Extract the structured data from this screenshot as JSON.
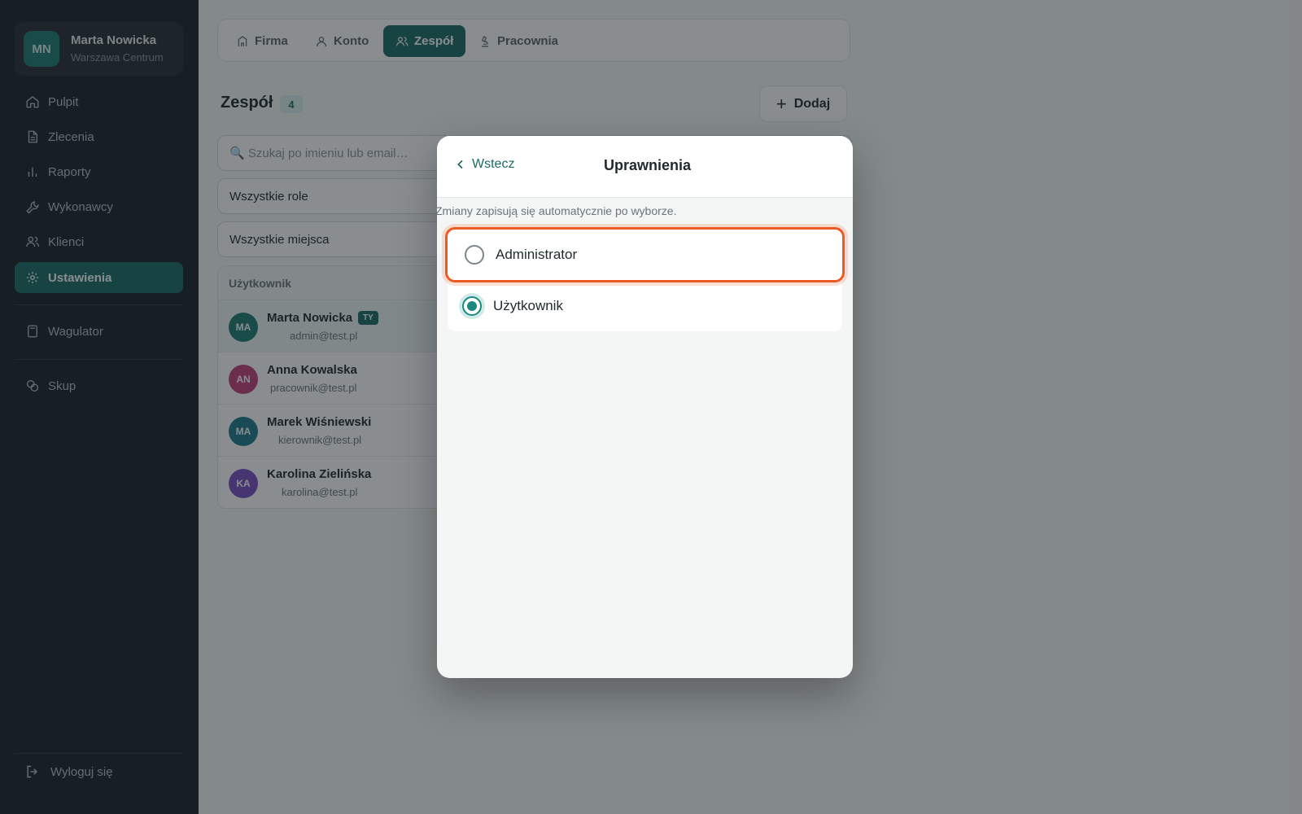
{
  "profile": {
    "initials": "MN",
    "name": "Marta Nowicka",
    "location": "Warszawa Centrum"
  },
  "sidebar": {
    "items": [
      {
        "label": "Pulpit",
        "icon": "home-icon"
      },
      {
        "label": "Zlecenia",
        "icon": "document-icon"
      },
      {
        "label": "Raporty",
        "icon": "bar-chart-icon"
      },
      {
        "label": "Wykonawcy",
        "icon": "wrench-icon"
      },
      {
        "label": "Klienci",
        "icon": "users-icon"
      },
      {
        "label": "Ustawienia",
        "icon": "gear-icon",
        "active": true
      },
      {
        "label": "Wagulator",
        "icon": "calculator-icon"
      },
      {
        "label": "Skup",
        "icon": "coins-icon"
      }
    ],
    "logout": "Wyloguj się"
  },
  "tabs": [
    {
      "label": "Firma",
      "icon": "building-icon"
    },
    {
      "label": "Konto",
      "icon": "user-icon"
    },
    {
      "label": "Zespół",
      "icon": "users-icon",
      "active": true
    },
    {
      "label": "Pracownia",
      "icon": "microscope-icon"
    }
  ],
  "team": {
    "title": "Zespół",
    "count": "4",
    "add_label": "Dodaj",
    "search_placeholder": "🔍 Szukaj po imieniu lub email…",
    "role_filter": "Wszystkie role",
    "place_filter": "Wszystkie miejsca",
    "column_user": "Użytkownik",
    "me_badge": "TY",
    "users": [
      {
        "initials": "MA",
        "name": "Marta Nowicka",
        "email": "admin@test.pl",
        "color": "#1f7a72",
        "me": true
      },
      {
        "initials": "AN",
        "name": "Anna Kowalska",
        "email": "pracownik@test.pl",
        "color": "#c2417a"
      },
      {
        "initials": "MA",
        "name": "Marek Wiśniewski",
        "email": "kierownik@test.pl",
        "color": "#1f7a8c"
      },
      {
        "initials": "KA",
        "name": "Karolina Zielińska",
        "email": "karolina@test.pl",
        "color": "#7a4fc4"
      }
    ]
  },
  "modal": {
    "back_label": "Wstecz",
    "title": "Uprawnienia",
    "hint": "Zmiany zapisują się automatycznie po wyborze.",
    "options": [
      {
        "label": "Administrator",
        "selected": false
      },
      {
        "label": "Użytkownik",
        "selected": true
      }
    ]
  },
  "colors": {
    "accent": "#1a6b64",
    "highlight": "#ee5a24",
    "sidebar_bg": "#1d2228"
  }
}
